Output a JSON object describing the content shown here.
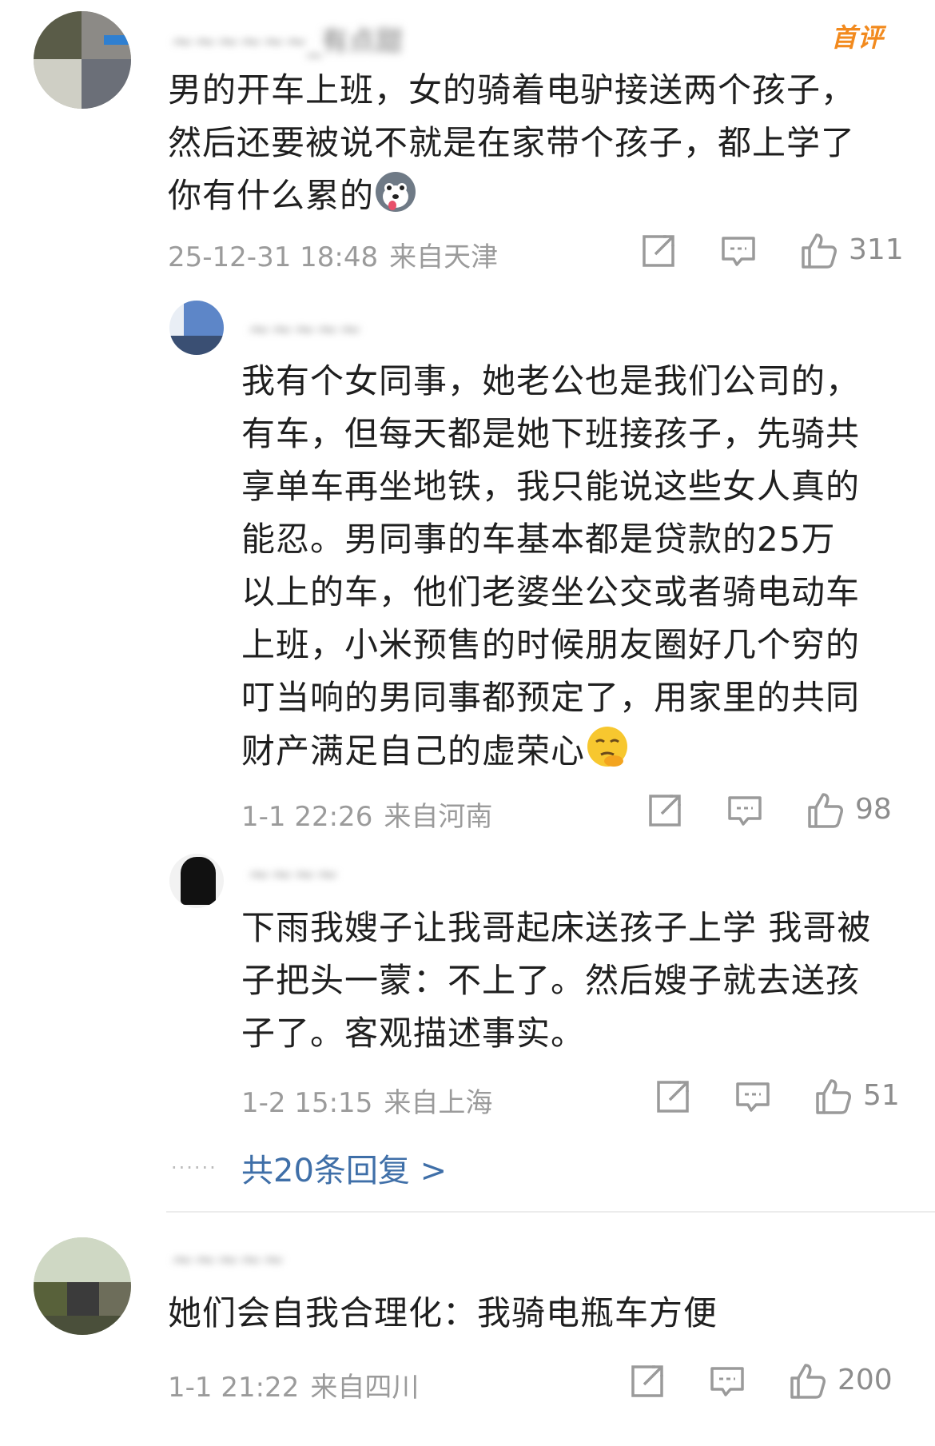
{
  "comments": [
    {
      "name": "~~~~~~_有点甜",
      "badge": "首评",
      "lines": [
        "男的开车上班，女的骑着电驴接送两个孩子，",
        "然后还要被说不就是在家带个孩子，都上学了",
        "你有什么累的"
      ],
      "emoji": "dog-face-emoji",
      "time": "25-12-31 18:48",
      "location": "来自天津",
      "likes": "311"
    },
    {
      "name": "~~~~~",
      "lines": [
        "我有个女同事，她老公也是我们公司的，",
        "有车，但每天都是她下班接孩子，先骑共",
        "享单车再坐地铁，我只能说这些女人真的",
        "能忍。男同事的车基本都是贷款的25万",
        "以上的车，他们老婆坐公交或者骑电动车",
        "上班，小米预售的时候朋友圈好几个穷的",
        "叮当响的男同事都预定了，用家里的共同",
        "财产满足自己的虚荣心"
      ],
      "emoji": "thinking-face-emoji",
      "time": "1-1 22:26",
      "location": "来自河南",
      "likes": "98"
    },
    {
      "name": "~~~~",
      "lines": [
        "下雨我嫂子让我哥起床送孩子上学 我哥被",
        "子把头一蒙：不上了。然后嫂子就去送孩",
        "子了。客观描述事实。"
      ],
      "time": "1-2 15:15",
      "location": "来自上海",
      "likes": "51"
    },
    {
      "name": "~~~~~",
      "lines": [
        "她们会自我合理化：我骑电瓶车方便"
      ],
      "time": "1-1 21:22",
      "location": "来自四川",
      "likes": "200"
    }
  ],
  "replies_link": "共20条回复 >",
  "dots": "......",
  "colors": {
    "link": "#3f6fa8",
    "meta": "#9b9b9b",
    "badge": "#f28a1e"
  }
}
